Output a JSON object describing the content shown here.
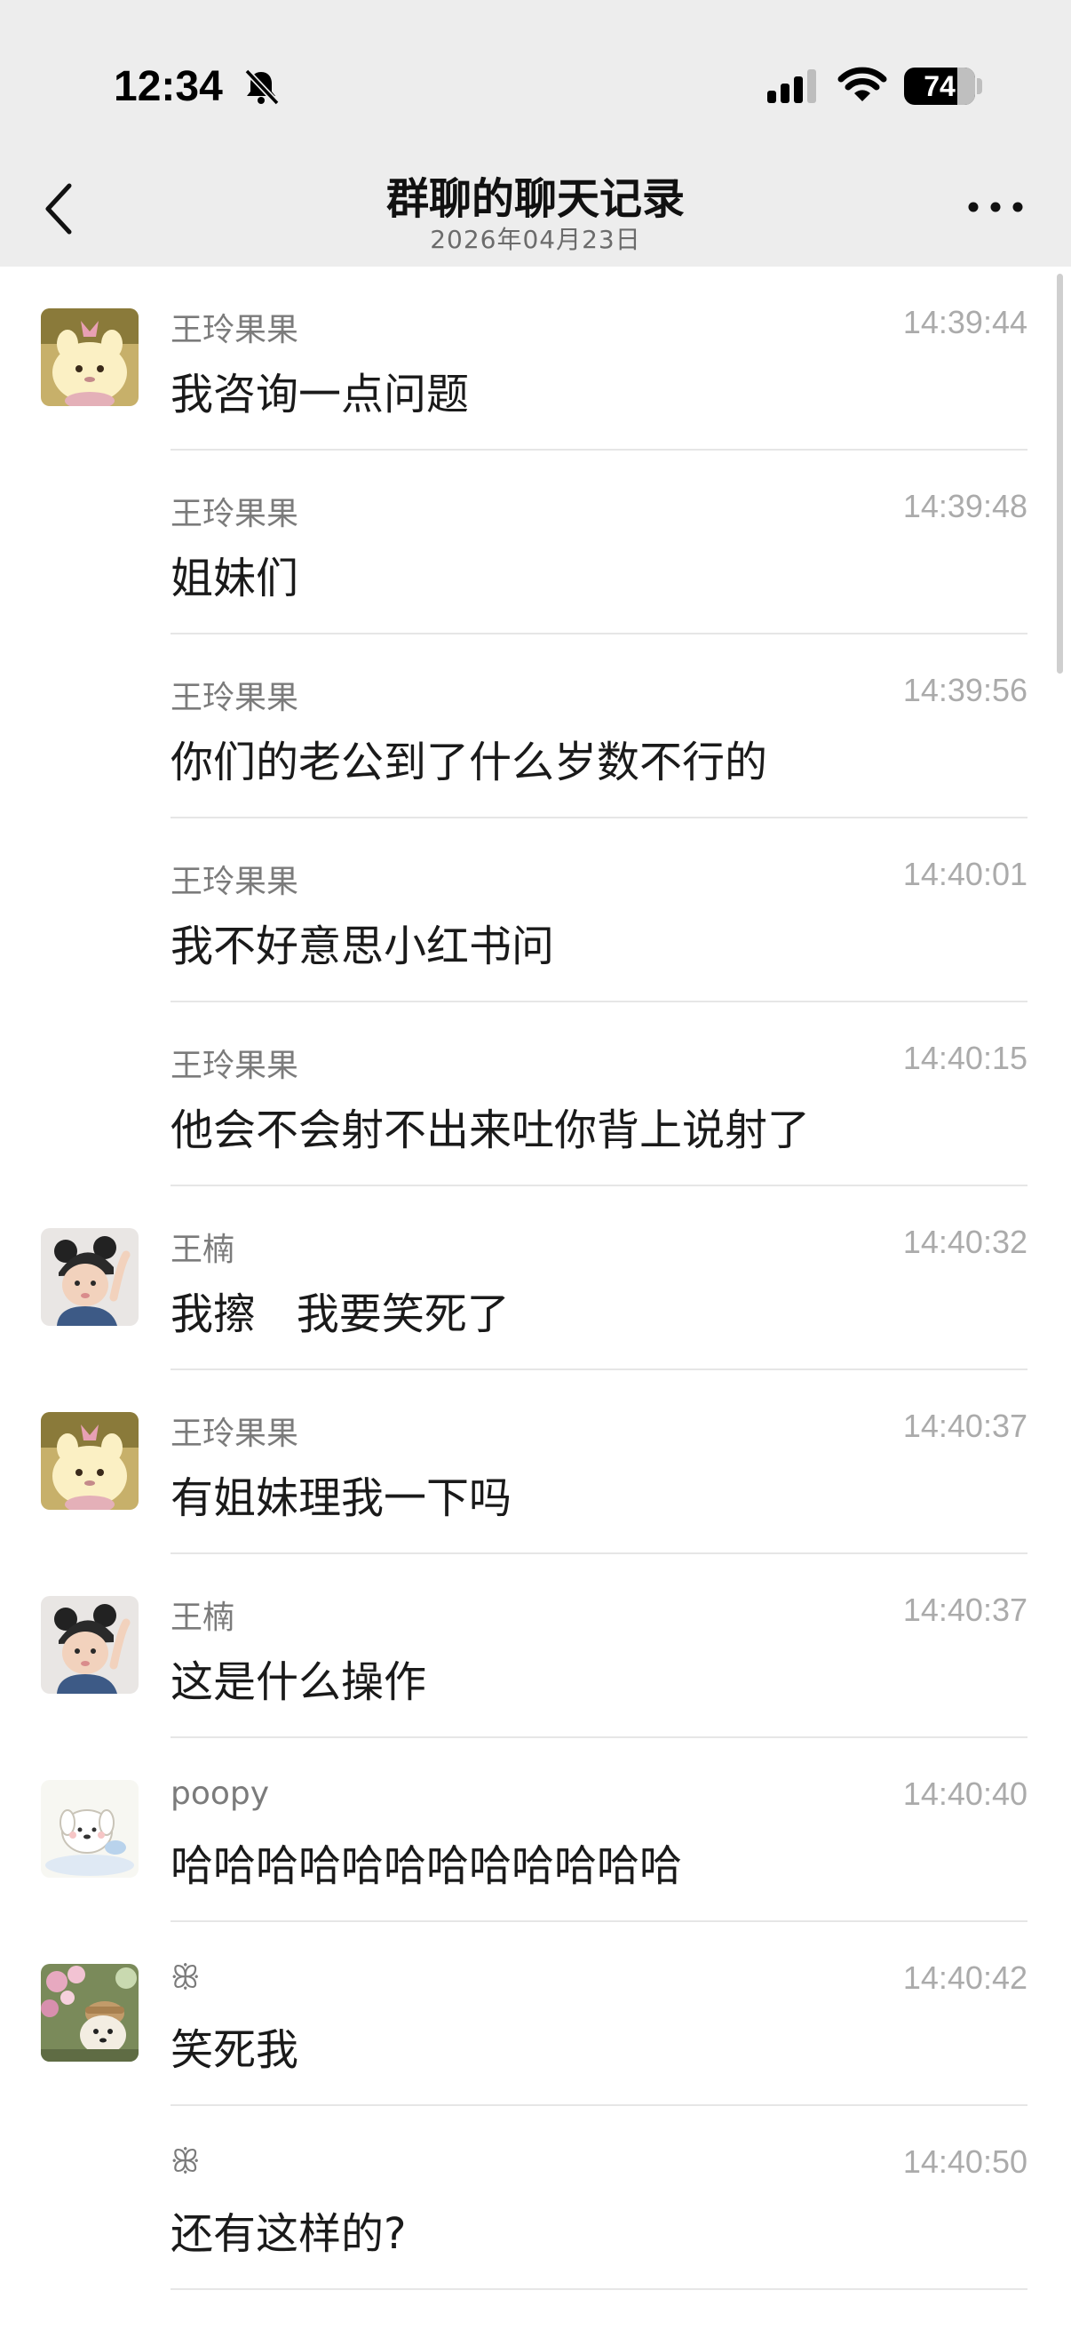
{
  "status_bar": {
    "time": "12:34",
    "battery": "74"
  },
  "header": {
    "title": "群聊的聊天记录",
    "subtitle": "2026年04月23日"
  },
  "messages": [
    {
      "sender": "王玲果果",
      "time": "14:39:44",
      "text": "我咨询一点问题",
      "avatar": "plush-bear"
    },
    {
      "sender": "王玲果果",
      "time": "14:39:48",
      "text": "姐妹们",
      "avatar": ""
    },
    {
      "sender": "王玲果果",
      "time": "14:39:56",
      "text": "你们的老公到了什么岁数不行的",
      "avatar": ""
    },
    {
      "sender": "王玲果果",
      "time": "14:40:01",
      "text": "我不好意思小红书问",
      "avatar": ""
    },
    {
      "sender": "王玲果果",
      "time": "14:40:15",
      "text": "他会不会射不出来吐你背上说射了",
      "avatar": ""
    },
    {
      "sender": "王楠",
      "time": "14:40:32",
      "text": "我擦   我要笑死了",
      "avatar": "baby"
    },
    {
      "sender": "王玲果果",
      "time": "14:40:37",
      "text": "有姐妹理我一下吗",
      "avatar": "plush-bear"
    },
    {
      "sender": "王楠",
      "time": "14:40:37",
      "text": "这是什么操作",
      "avatar": "baby"
    },
    {
      "sender": "poopy",
      "time": "14:40:40",
      "text": "哈哈哈哈哈哈哈哈哈哈哈哈",
      "avatar": "cartoon-dog"
    },
    {
      "sender": "ꕥ",
      "time": "14:40:42",
      "text": "笑死我",
      "avatar": "flower-plush"
    },
    {
      "sender": "ꕥ",
      "time": "14:40:50",
      "text": "还有这样的?",
      "avatar": ""
    }
  ]
}
